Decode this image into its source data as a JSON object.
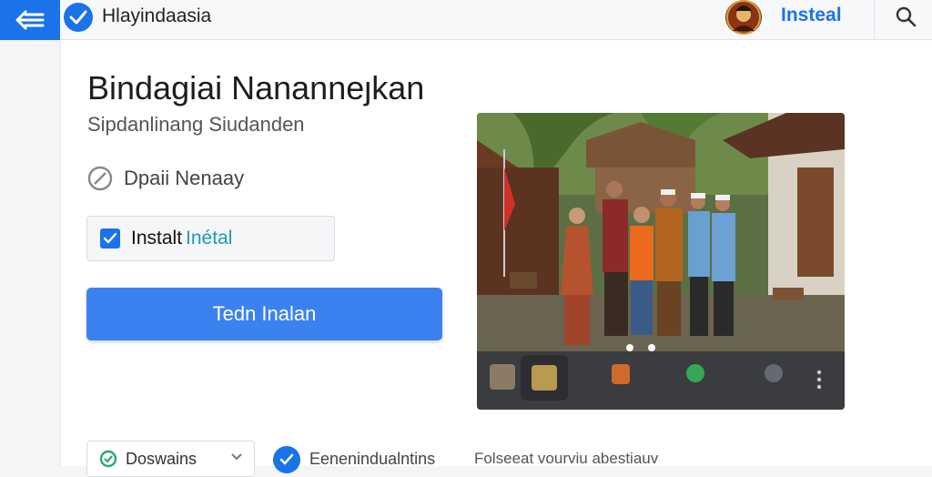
{
  "header": {
    "brand_name": "Hlayindaasia",
    "install_label": "Insteal"
  },
  "main": {
    "title": "Bindagiai Nananneȷkan",
    "subtitle": "Sipdanlinang Siudanden",
    "status_text": "Dpaii Nenaay",
    "checkbox_label": "Instalt",
    "checkbox_label_accent": "Inétal",
    "primary_button_label": "Tedn Inalan"
  },
  "footer": {
    "select_value": "Doswains",
    "middle_text": "Eenenindualntins",
    "right_text": "Folseeat vourviu abestiauv"
  },
  "media": {
    "thumbnails": [
      "thumb-1",
      "thumb-2",
      "thumb-3",
      "thumb-4",
      "thumb-5"
    ],
    "selected_thumbnail": 2,
    "carousel_dots": 2
  },
  "colors": {
    "accent": "#1a73e8",
    "button": "#3b82f0",
    "checkbox_accent_text": "#1a9bb0"
  },
  "icons": [
    "back-arrow-icon",
    "verified-badge-icon",
    "search-icon",
    "blocked-icon",
    "check-icon",
    "chevron-down-icon",
    "more-vert-icon"
  ]
}
